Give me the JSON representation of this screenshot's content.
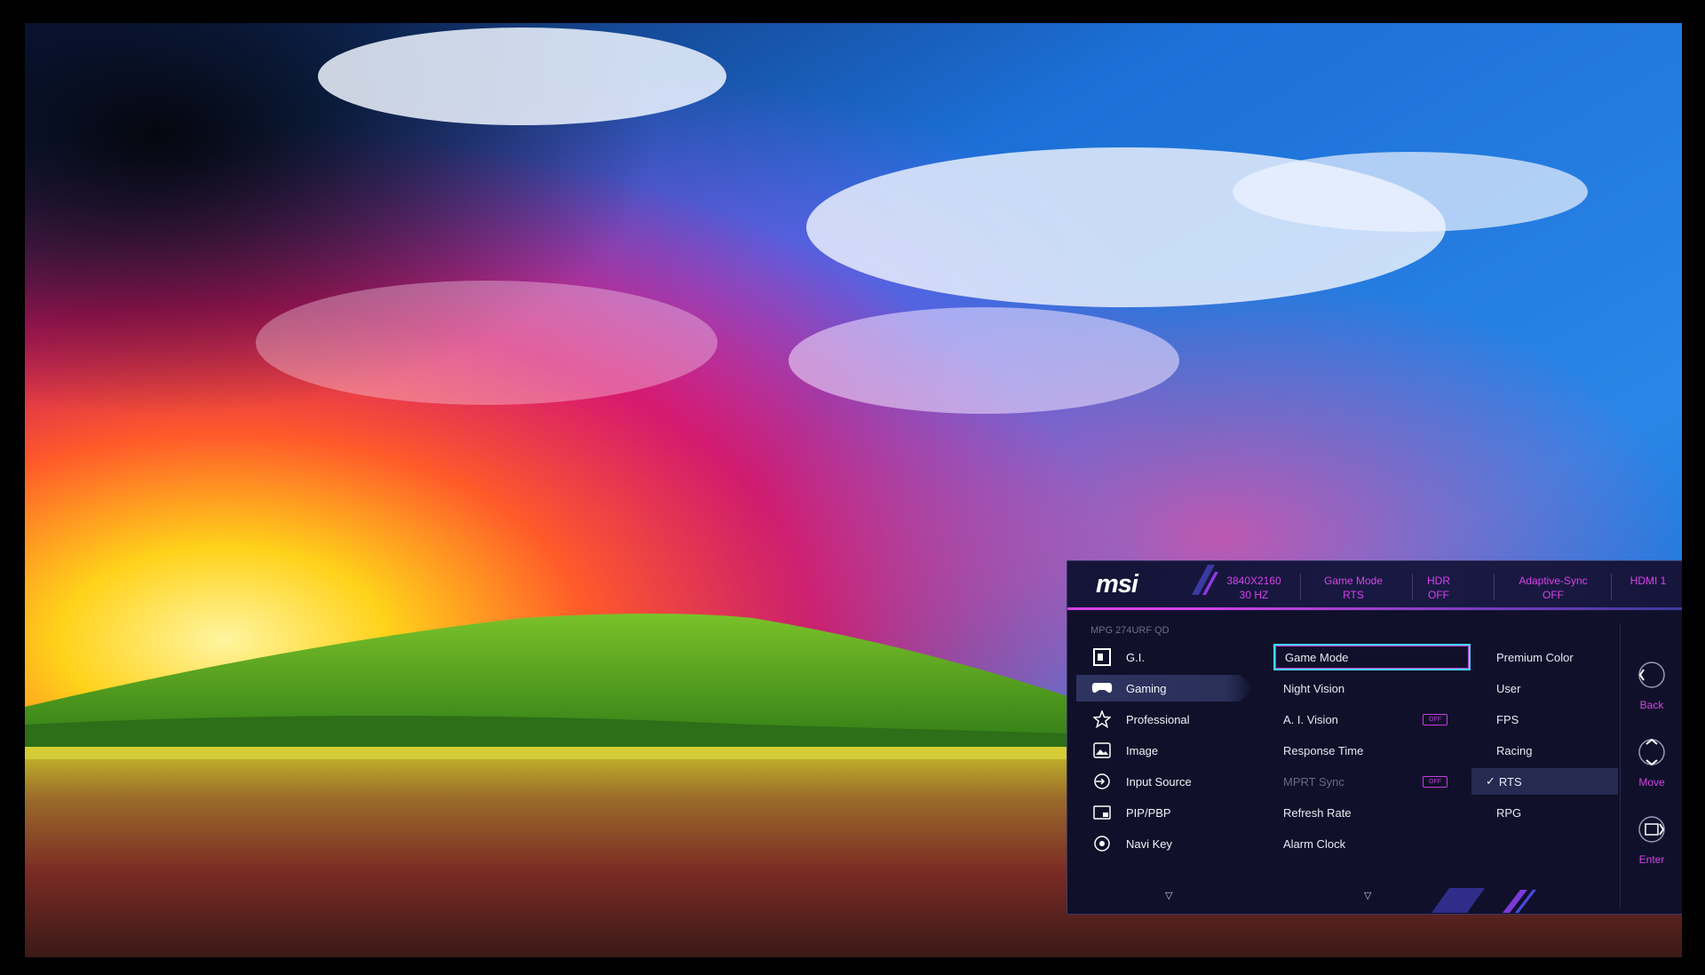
{
  "osd": {
    "brand": "msi",
    "model": "MPG 274URF QD",
    "status": [
      {
        "line1": "3840X2160",
        "line2": "30 HZ"
      },
      {
        "line1": "Game Mode",
        "line2": "RTS"
      },
      {
        "line1": "HDR",
        "line2": "OFF"
      },
      {
        "line1": "Adaptive-Sync",
        "line2": "OFF"
      },
      {
        "line1": "HDMI 1",
        "line2": ""
      }
    ],
    "main_menu": [
      "G.I.",
      "Gaming",
      "Professional",
      "Image",
      "Input Source",
      "PIP/PBP",
      "Navi Key"
    ],
    "active_main": "Gaming",
    "sub_menu": [
      "Game Mode",
      "Night Vision",
      "A. I. Vision",
      "Response Time",
      "MPRT Sync",
      "Refresh Rate",
      "Alarm Clock"
    ],
    "selected_sub": "Game Mode",
    "toggle_label": "OFF",
    "options": [
      "Premium Color",
      "User",
      "FPS",
      "Racing",
      "RTS",
      "RPG"
    ],
    "checked_option": "RTS",
    "controls": [
      "Back",
      "Move",
      "Enter"
    ],
    "accent_color": "#d643e8",
    "selection_color": "#3fd6f0"
  }
}
